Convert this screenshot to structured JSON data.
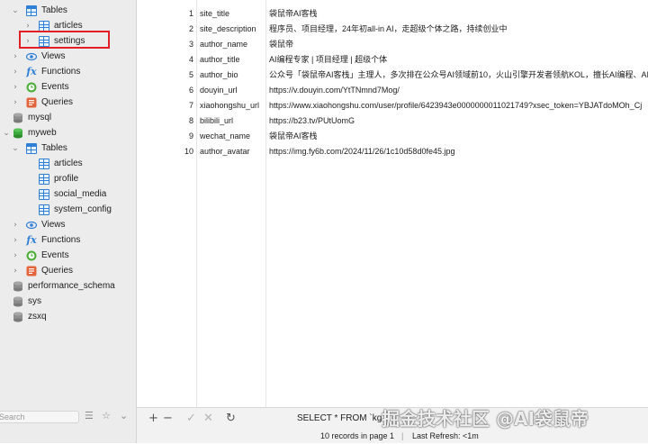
{
  "sidebar": {
    "tree": [
      {
        "label": "Tables",
        "icon": "table-folder-icon",
        "state": "expanded",
        "level": 1
      },
      {
        "label": "articles",
        "icon": "table-icon",
        "state": "collapsed",
        "level": 2
      },
      {
        "label": "settings",
        "icon": "table-icon",
        "state": "collapsed",
        "level": 2,
        "highlighted": true
      },
      {
        "label": "Views",
        "icon": "views-icon",
        "state": "collapsed",
        "level": 1
      },
      {
        "label": "Functions",
        "icon": "function-icon",
        "state": "collapsed",
        "level": 1
      },
      {
        "label": "Events",
        "icon": "event-icon",
        "state": "collapsed",
        "level": 1
      },
      {
        "label": "Queries",
        "icon": "query-icon",
        "state": "collapsed",
        "level": 1
      },
      {
        "label": "mysql",
        "icon": "database-icon",
        "state": "none",
        "level": 0
      },
      {
        "label": "myweb",
        "icon": "database-active-icon",
        "state": "expanded",
        "level": 0
      },
      {
        "label": "Tables",
        "icon": "table-folder-icon",
        "state": "expanded",
        "level": 1
      },
      {
        "label": "articles",
        "icon": "table-icon",
        "state": "none",
        "level": 2
      },
      {
        "label": "profile",
        "icon": "table-icon",
        "state": "none",
        "level": 2
      },
      {
        "label": "social_media",
        "icon": "table-icon",
        "state": "none",
        "level": 2
      },
      {
        "label": "system_config",
        "icon": "table-icon",
        "state": "none",
        "level": 2
      },
      {
        "label": "Views",
        "icon": "views-icon",
        "state": "collapsed",
        "level": 1
      },
      {
        "label": "Functions",
        "icon": "function-icon",
        "state": "collapsed",
        "level": 1
      },
      {
        "label": "Events",
        "icon": "event-icon",
        "state": "collapsed",
        "level": 1
      },
      {
        "label": "Queries",
        "icon": "query-icon",
        "state": "collapsed",
        "level": 1
      },
      {
        "label": "performance_schema",
        "icon": "database-icon",
        "state": "none",
        "level": 0
      },
      {
        "label": "sys",
        "icon": "database-icon",
        "state": "none",
        "level": 0
      },
      {
        "label": "zsxq",
        "icon": "database-icon",
        "state": "none",
        "level": 0
      }
    ],
    "search_placeholder": "Search",
    "colors": {
      "accent": "#2f7fd6",
      "highlight_border": "#e01f26",
      "event_green": "#4eae3a",
      "query_orange": "#e3643b"
    }
  },
  "grid": {
    "rows": [
      {
        "num": "1",
        "name": "site_title",
        "value": "袋鼠帝AI客栈"
      },
      {
        "num": "2",
        "name": "site_description",
        "value": "程序员、项目经理，24年初all-in AI，走超级个体之路，持续创业中"
      },
      {
        "num": "3",
        "name": "author_name",
        "value": "袋鼠帝"
      },
      {
        "num": "4",
        "name": "author_title",
        "value": "AI编程专家 | 项目经理 | 超级个体"
      },
      {
        "num": "5",
        "name": "author_bio",
        "value": "公众号「袋鼠帝AI客栈」主理人，多次排在公众号AI领域前10，火山引擎开发者领航KOL，擅长AI编程、AI A"
      },
      {
        "num": "6",
        "name": "douyin_url",
        "value": "https://v.douyin.com/YtTNmnd7Mog/"
      },
      {
        "num": "7",
        "name": "xiaohongshu_url",
        "value": "https://www.xiaohongshu.com/user/profile/6423943e0000000011021749?xsec_token=YBJATdoMOh_Cj"
      },
      {
        "num": "8",
        "name": "bilibili_url",
        "value": "https://b23.tv/PUtUomG"
      },
      {
        "num": "9",
        "name": "wechat_name",
        "value": "袋鼠帝AI客栈"
      },
      {
        "num": "10",
        "name": "author_avatar",
        "value": "https://img.fy6b.com/2024/11/26/1c10d58d0fe45.jpg"
      }
    ]
  },
  "toolbar": {
    "add": "+",
    "remove": "−",
    "commit": "✓",
    "discard": "✕",
    "refresh": "↻",
    "sql": "SELECT * FROM `kg"
  },
  "status": {
    "records": "10 records in page 1",
    "refresh": "Last Refresh: <1m"
  },
  "watermark": "掘金技术社区 @AI袋鼠帝"
}
